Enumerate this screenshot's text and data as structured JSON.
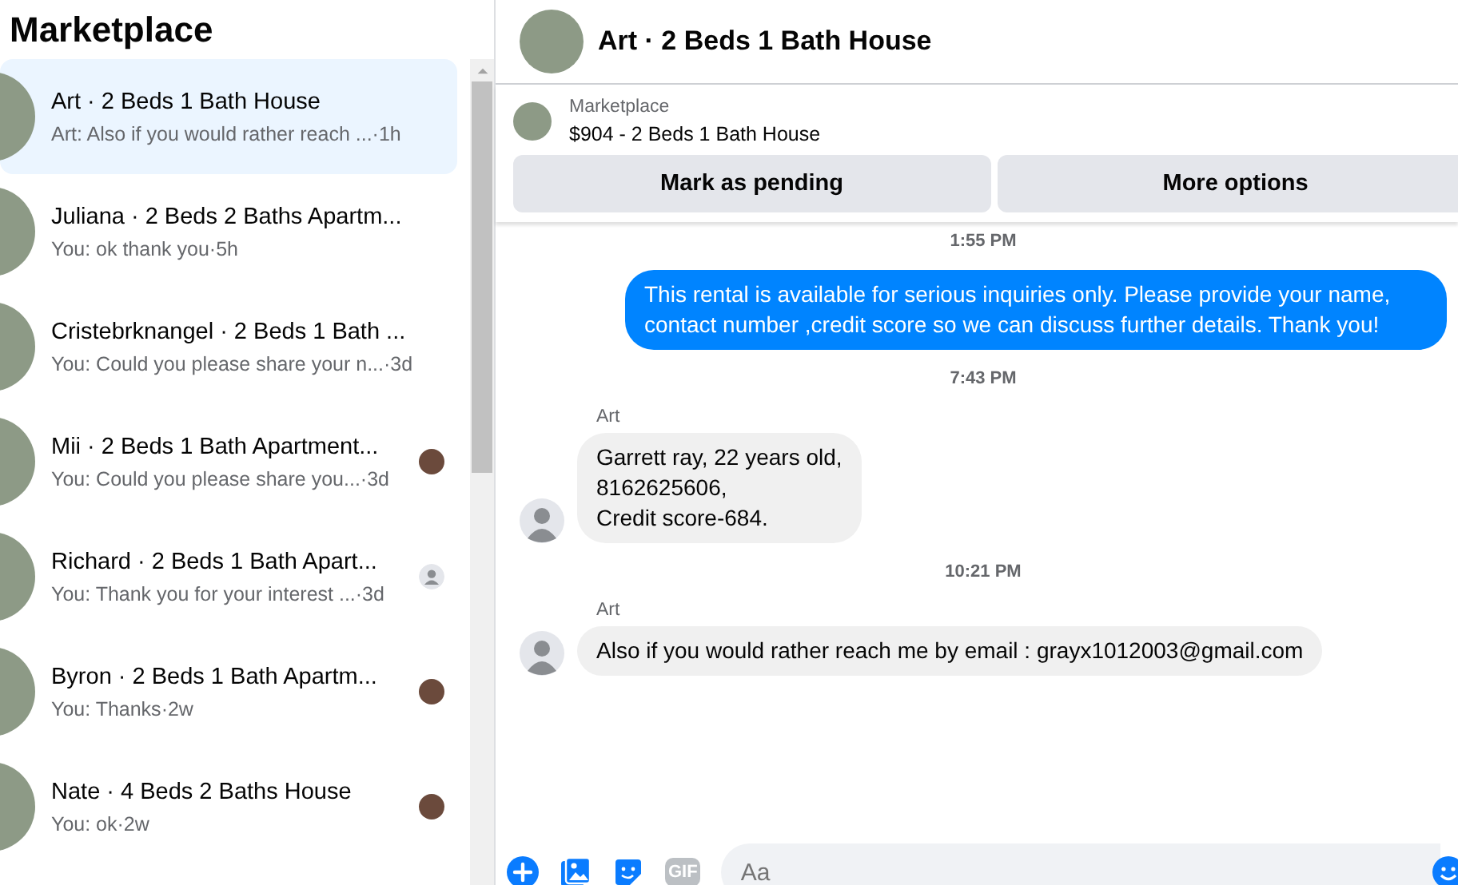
{
  "sidebar": {
    "title": "Marketplace",
    "conversations": [
      {
        "kind": "plain",
        "name": "Art · 2 Beds 1 Bath House",
        "snippet": "Art: Also if you would rather reach ... ",
        "time": "·1h",
        "selected": true
      },
      {
        "kind": "plain",
        "name": "Juliana · 2 Beds 2 Baths Apartm...",
        "snippet": "You: ok thank you",
        "time": "·5h",
        "selected": false
      },
      {
        "kind": "plain",
        "name": "Cristebrknangel · 2 Beds 1 Bath ...",
        "snippet": "You: Could you please share your n...",
        "time": "·3d",
        "selected": false
      },
      {
        "kind": "seen_photo",
        "name": "Mii · 2 Beds 1 Bath Apartment...",
        "snippet": "You: Could you please share you...",
        "time": "·3d",
        "selected": false
      },
      {
        "kind": "seen_default",
        "name": "Richard · 2 Beds 1 Bath Apart...",
        "snippet": "You: Thank you for your interest ...",
        "time": "·3d",
        "selected": false
      },
      {
        "kind": "seen_photo",
        "name": "Byron · 2 Beds 1 Bath Apartm...",
        "snippet": "You: Thanks",
        "time": "·2w",
        "selected": false
      },
      {
        "kind": "seen_photo",
        "name": "Nate · 4 Beds 2 Baths House",
        "snippet": "You: ok",
        "time": "·2w",
        "selected": false
      }
    ]
  },
  "chat": {
    "title": "Art · 2 Beds 1 Bath House",
    "listing": {
      "label": "Marketplace",
      "title": "$904 - 2 Beds 1 Bath House",
      "buttons": [
        "Mark as pending",
        "More options"
      ]
    },
    "messages": [
      {
        "kind": "timestamp",
        "text": "1:55 PM"
      },
      {
        "kind": "outgoing",
        "text": "This rental is available for serious inquiries only. Please provide your name, contact number ,credit score so  we can discuss further details. Thank you!"
      },
      {
        "kind": "timestamp",
        "text": "7:43 PM"
      },
      {
        "kind": "incoming",
        "sender": "Art",
        "text": "Garrett ray, 22 years old,\n8162625606,\nCredit score-684."
      },
      {
        "kind": "timestamp",
        "text": "10:21 PM"
      },
      {
        "kind": "incoming",
        "sender": "Art",
        "text": "Also if you would rather reach me by email : grayx1012003@gmail.com"
      }
    ],
    "composer": {
      "gif_label": "GIF",
      "placeholder": "Aa"
    }
  }
}
